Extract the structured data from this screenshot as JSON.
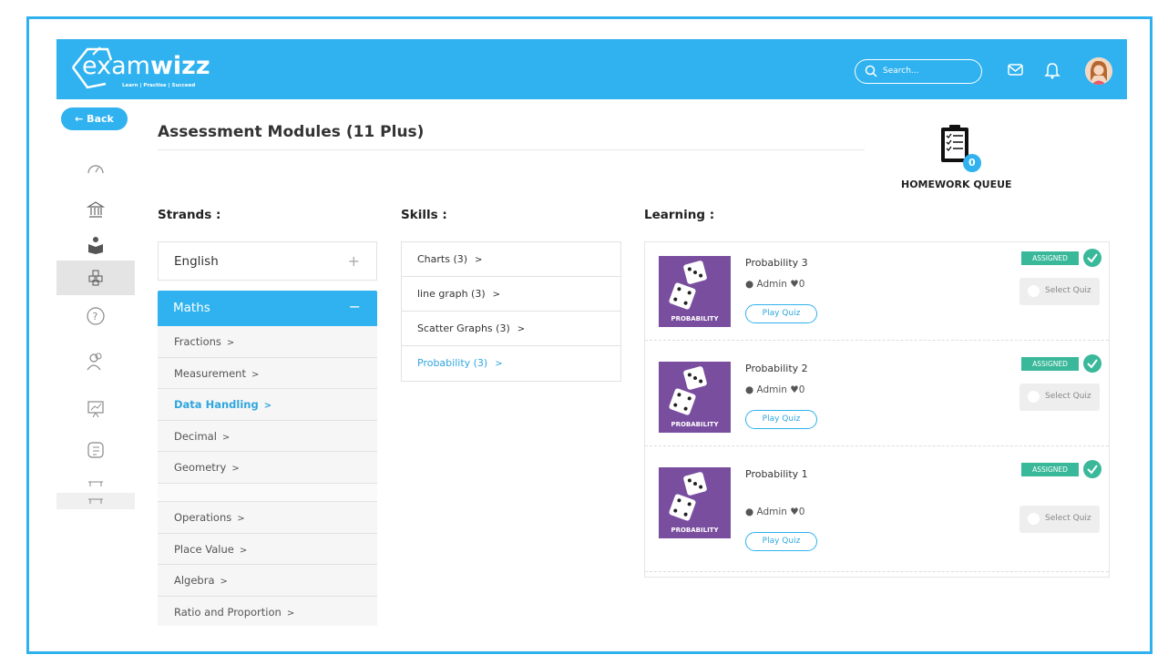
{
  "brand": {
    "name_light": "exam",
    "name_bold": "wizz",
    "tagline": "Learn | Practise | Succeed"
  },
  "header": {
    "search_placeholder": "Search...",
    "icons": [
      "search-icon",
      "mail-icon",
      "bell-icon",
      "avatar"
    ]
  },
  "sidebar": {
    "back_label": "← Back",
    "items": [
      "speedometer-icon",
      "institution-icon",
      "reading-icon",
      "modules-icon",
      "help-icon",
      "users-icon",
      "presentation-icon",
      "checklist-icon",
      "scroll-icon",
      "scroll-icon"
    ]
  },
  "page": {
    "title": "Assessment Modules (11 Plus)"
  },
  "homework": {
    "count": "0",
    "label": "HOMEWORK QUEUE"
  },
  "strands": {
    "heading": "Strands :",
    "english": "English",
    "maths": "Maths",
    "subs": [
      "Fractions",
      "Measurement",
      "Data Handling",
      "Decimal",
      "Geometry",
      "",
      "Operations",
      "Place Value",
      "Algebra",
      "Ratio and Proportion"
    ]
  },
  "skills": {
    "heading": "Skills :",
    "items": [
      "Charts (3)",
      "line graph (3)",
      "Scatter Graphs (3)",
      "Probability (3)"
    ]
  },
  "learning": {
    "heading": "Learning :",
    "cards": [
      {
        "title": "Probability 3",
        "meta": "Admin ♥0",
        "play": "Play Quiz",
        "badge": "ASSIGNED",
        "select": "Select Quiz",
        "thumb": "PROBABILITY"
      },
      {
        "title": "Probability 2",
        "meta": "Admin ♥0",
        "play": "Play Quiz",
        "badge": "ASSIGNED",
        "select": "Select Quiz",
        "thumb": "PROBABILITY"
      },
      {
        "title": "Probability 1",
        "meta": "Admin ♥0",
        "play": "Play Quiz",
        "badge": "ASSIGNED",
        "select": "Select Quiz",
        "thumb": "PROBABILITY"
      }
    ]
  },
  "colors": {
    "accent": "#2fb2ef",
    "assigned": "#3ab89a",
    "thumb": "#7a4e9f"
  }
}
